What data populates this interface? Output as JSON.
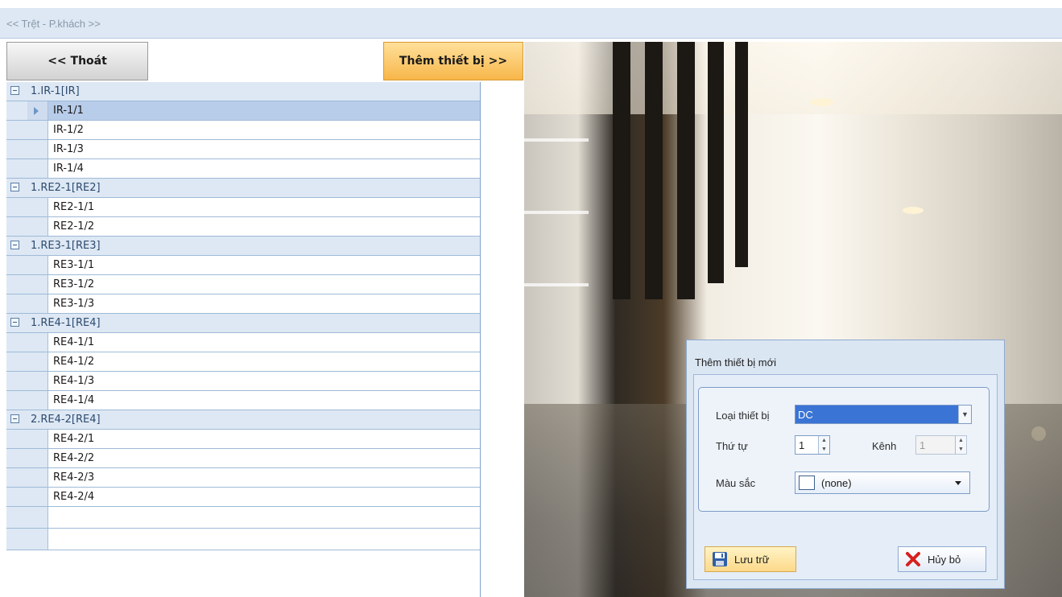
{
  "breadcrumb": "<< Trệt - P.khách >>",
  "toolbar": {
    "exit_label": "<< Thoát",
    "add_device_label": "Thêm thiết bị >>"
  },
  "device_tree": [
    {
      "group": "1.IR-1[IR]",
      "items": [
        "IR-1/1",
        "IR-1/2",
        "IR-1/3",
        "IR-1/4"
      ]
    },
    {
      "group": "1.RE2-1[RE2]",
      "items": [
        "RE2-1/1",
        "RE2-1/2"
      ]
    },
    {
      "group": "1.RE3-1[RE3]",
      "items": [
        "RE3-1/1",
        "RE3-1/2",
        "RE3-1/3"
      ]
    },
    {
      "group": "1.RE4-1[RE4]",
      "items": [
        "RE4-1/1",
        "RE4-1/2",
        "RE4-1/3",
        "RE4-1/4"
      ]
    },
    {
      "group": "2.RE4-2[RE4]",
      "items": [
        "RE4-2/1",
        "RE4-2/2",
        "RE4-2/3",
        "RE4-2/4"
      ]
    }
  ],
  "selected_item": "IR-1/1",
  "dialog": {
    "title": "Thêm thiết bị mới",
    "device_type_label": "Loại thiết bị",
    "device_type_value": "DC",
    "order_label": "Thứ tự",
    "order_value": "1",
    "channel_label": "Kênh",
    "channel_value": "1",
    "color_label": "Màu sắc",
    "color_value": "(none)",
    "save_label": "Lưu trữ",
    "cancel_label": "Hủy bỏ"
  },
  "colors": {
    "accent_orange": "#f7b64a",
    "row_header": "#dde8f4",
    "selected_row": "#b8cdea",
    "combo_highlight": "#3a74d4",
    "cancel_red": "#d62020"
  }
}
